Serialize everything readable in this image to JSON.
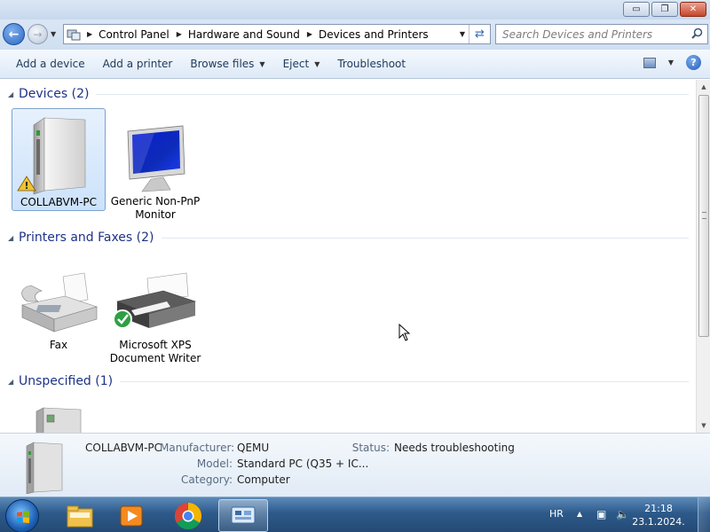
{
  "window": {
    "controls": {
      "minimize": "▭",
      "maximize": "❐",
      "close": "✕"
    }
  },
  "navigation": {
    "back_icon": "back-arrow-icon",
    "forward_icon": "forward-arrow-icon",
    "breadcrumbs": [
      "Control Panel",
      "Hardware and Sound",
      "Devices and Printers"
    ],
    "search_placeholder": "Search Devices and Printers"
  },
  "toolbar": {
    "add_device": "Add a device",
    "add_printer": "Add a printer",
    "browse_files": "Browse files",
    "eject": "Eject",
    "troubleshoot": "Troubleshoot"
  },
  "groups": {
    "devices": {
      "title": "Devices (2)",
      "items": [
        {
          "line1": "COLLABVM-PC",
          "line2": "",
          "icon": "computer-tower-warning-icon",
          "selected": true
        },
        {
          "line1": "Generic Non-PnP",
          "line2": "Monitor",
          "icon": "monitor-icon",
          "selected": false
        }
      ]
    },
    "printers": {
      "title": "Printers and Faxes (2)",
      "items": [
        {
          "line1": "Fax",
          "line2": "",
          "icon": "fax-icon",
          "selected": false
        },
        {
          "line1": "Microsoft XPS",
          "line2": "Document Writer",
          "icon": "printer-default-icon",
          "selected": false
        }
      ]
    },
    "unspecified": {
      "title": "Unspecified (1)",
      "items": [
        {
          "line1": "",
          "line2": "",
          "icon": "server-tower-icon",
          "selected": false
        }
      ]
    }
  },
  "details": {
    "name": "COLLABVM-PC",
    "manufacturer_key": "Manufacturer:",
    "manufacturer_value": "QEMU",
    "model_key": "Model:",
    "model_value": "Standard PC (Q35 + IC...",
    "category_key": "Category:",
    "category_value": "Computer",
    "status_key": "Status:",
    "status_value": "Needs troubleshooting"
  },
  "taskbar": {
    "apps": [
      "file-explorer-icon",
      "media-player-icon",
      "chrome-icon",
      "devices-and-printers-icon"
    ],
    "language": "HR",
    "time": "21:18",
    "date": "23.1.2024."
  },
  "colors": {
    "group_title": "#1e3287",
    "selection": "#cce2fb",
    "taskbar": "#2d5a8a"
  }
}
